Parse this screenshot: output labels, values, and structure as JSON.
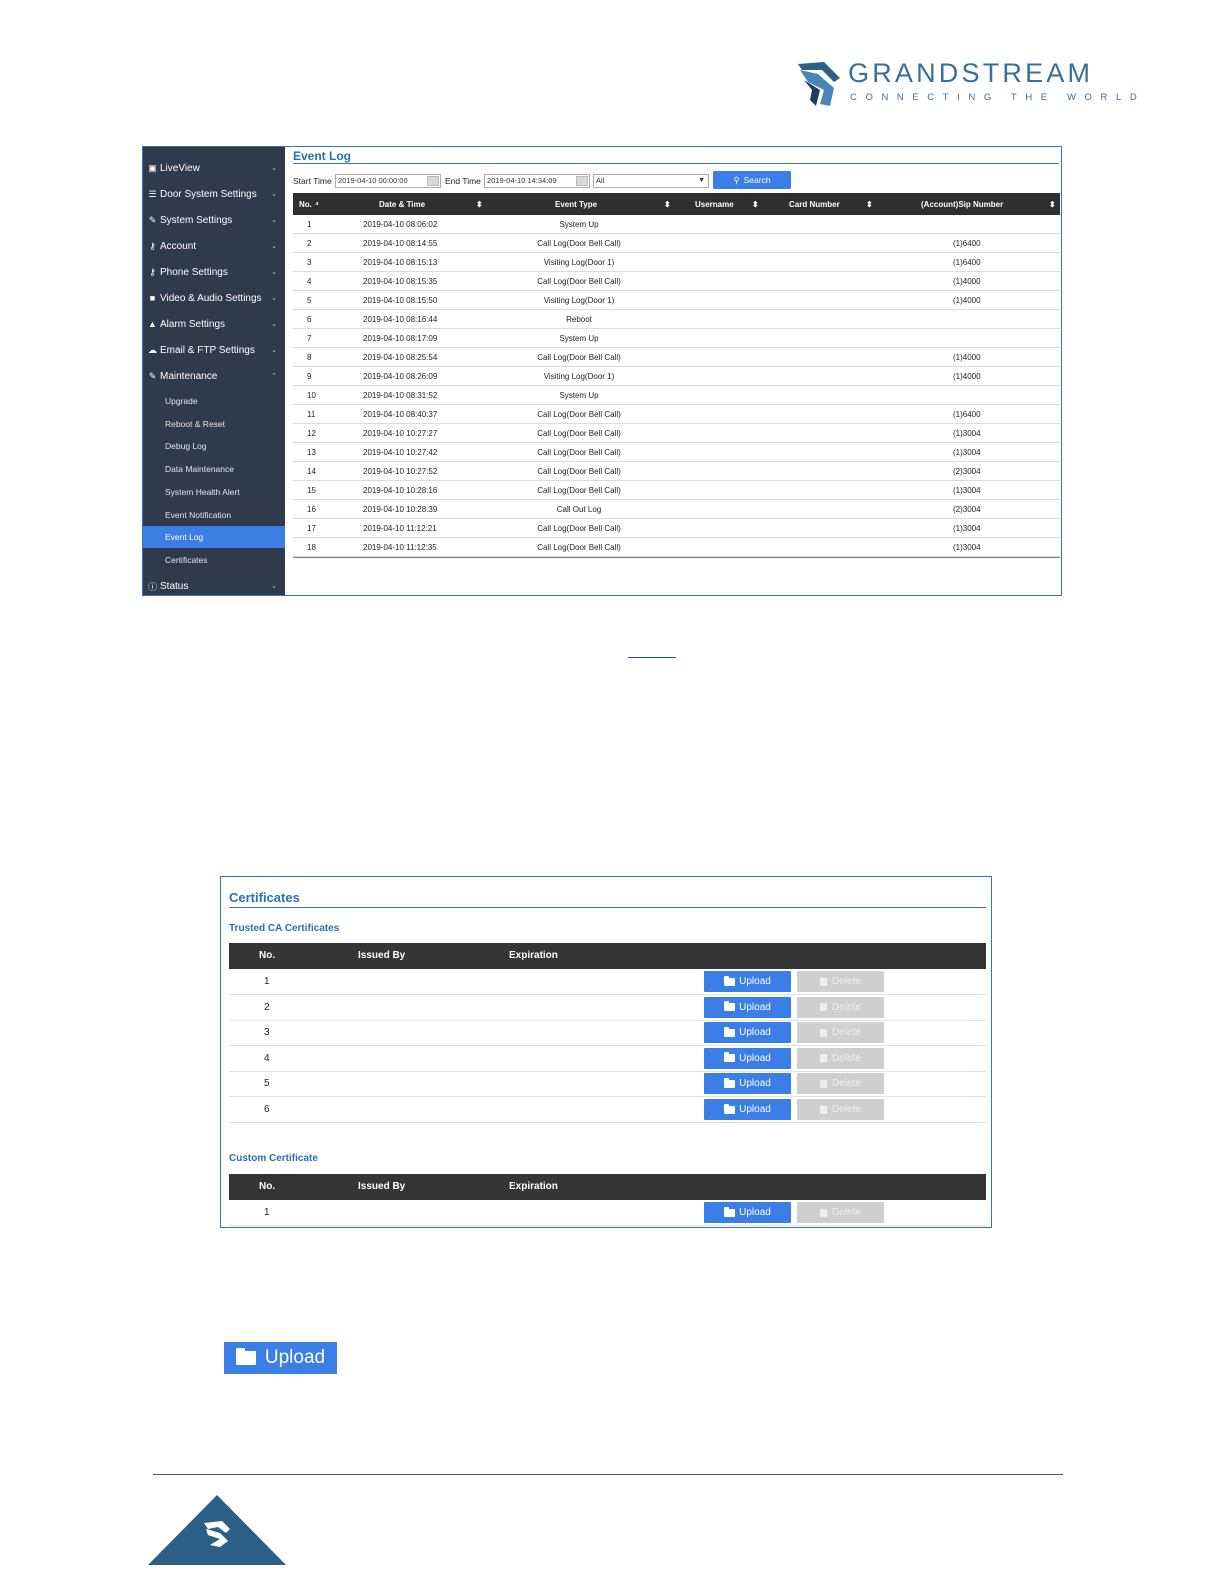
{
  "brand": {
    "name": "GRANDSTREAM",
    "tagline": "CONNECTING THE WORLD",
    "color": "#3a6f9a"
  },
  "event_log": {
    "sidebar": {
      "items": [
        {
          "icon": "video-icon",
          "label": "LiveView"
        },
        {
          "icon": "door-icon",
          "label": "Door System Settings"
        },
        {
          "icon": "wrench-icon",
          "label": "System Settings"
        },
        {
          "icon": "key-icon",
          "label": "Account"
        },
        {
          "icon": "key-icon",
          "label": "Phone Settings"
        },
        {
          "icon": "camera-icon",
          "label": "Video & Audio Settings"
        },
        {
          "icon": "bell-icon",
          "label": "Alarm Settings"
        },
        {
          "icon": "cloud-icon",
          "label": "Email & FTP Settings"
        },
        {
          "icon": "wrench-icon",
          "label": "Maintenance"
        }
      ],
      "sub_items": [
        "Upgrade",
        "Reboot & Reset",
        "Debug Log",
        "Data Maintenance",
        "System Health Alert",
        "Event Notification",
        "Event Log",
        "Certificates"
      ],
      "active_sub": "Event Log",
      "status_label": "Status"
    },
    "title": "Event Log",
    "filters": {
      "start_label": "Start Time",
      "start_value": "2019-04-10 00:00:00",
      "end_label": "End Time",
      "end_value": "2019-04-10 14:34:09",
      "type_value": "All",
      "search_label": "Search"
    },
    "columns": [
      "No.",
      "Date & Time",
      "Event Type",
      "Username",
      "Card Number",
      "(Account)Sip Number"
    ],
    "rows": [
      {
        "no": "1",
        "time": "2019-04-10 08:06:02",
        "type": "System Up",
        "sip": ""
      },
      {
        "no": "2",
        "time": "2019-04-10 08:14:55",
        "type": "Call Log(Door Bell Call)",
        "sip": "(1)6400"
      },
      {
        "no": "3",
        "time": "2019-04-10 08:15:13",
        "type": "Visiting Log(Door 1)",
        "sip": "(1)6400"
      },
      {
        "no": "4",
        "time": "2019-04-10 08:15:35",
        "type": "Call Log(Door Bell Call)",
        "sip": "(1)4000"
      },
      {
        "no": "5",
        "time": "2019-04-10 08:15:50",
        "type": "Visiting Log(Door 1)",
        "sip": "(1)4000"
      },
      {
        "no": "6",
        "time": "2019-04-10 08:16:44",
        "type": "Reboot",
        "sip": ""
      },
      {
        "no": "7",
        "time": "2019-04-10 08:17:09",
        "type": "System Up",
        "sip": ""
      },
      {
        "no": "8",
        "time": "2019-04-10 08:25:54",
        "type": "Call Log(Door Bell Call)",
        "sip": "(1)4000"
      },
      {
        "no": "9",
        "time": "2019-04-10 08:26:09",
        "type": "Visiting Log(Door 1)",
        "sip": "(1)4000"
      },
      {
        "no": "10",
        "time": "2019-04-10 08:31:52",
        "type": "System Up",
        "sip": ""
      },
      {
        "no": "11",
        "time": "2019-04-10 08:40:37",
        "type": "Call Log(Door Bell Call)",
        "sip": "(1)6400"
      },
      {
        "no": "12",
        "time": "2019-04-10 10:27:27",
        "type": "Call Log(Door Bell Call)",
        "sip": "(1)3004"
      },
      {
        "no": "13",
        "time": "2019-04-10 10:27:42",
        "type": "Call Log(Door Bell Call)",
        "sip": "(1)3004"
      },
      {
        "no": "14",
        "time": "2019-04-10 10:27:52",
        "type": "Call Log(Door Bell Call)",
        "sip": "(2)3004"
      },
      {
        "no": "15",
        "time": "2019-04-10 10:28:16",
        "type": "Call Log(Door Bell Call)",
        "sip": "(1)3004"
      },
      {
        "no": "16",
        "time": "2019-04-10 10:28:39",
        "type": "Call Out Log",
        "sip": "(2)3004"
      },
      {
        "no": "17",
        "time": "2019-04-10 11:12:21",
        "type": "Call Log(Door Bell Call)",
        "sip": "(1)3004"
      },
      {
        "no": "18",
        "time": "2019-04-10 11:12:35",
        "type": "Call Log(Door Bell Call)",
        "sip": "(1)3004"
      }
    ]
  },
  "certificates": {
    "title": "Certificates",
    "trusted_label": "Trusted CA Certificates",
    "custom_label": "Custom Certificate",
    "columns": [
      "No.",
      "Issued By",
      "Expiration"
    ],
    "trusted_rows": [
      "1",
      "2",
      "3",
      "4",
      "5",
      "6"
    ],
    "custom_rows": [
      "1"
    ],
    "upload_label": "Upload",
    "delete_label": "Delete"
  },
  "upload_icon_label": "Upload",
  "colors": {
    "accent": "#3a7ee6",
    "sidebar": "#2f3a4a",
    "header": "#2f2f2f",
    "title": "#2a6fb8"
  }
}
